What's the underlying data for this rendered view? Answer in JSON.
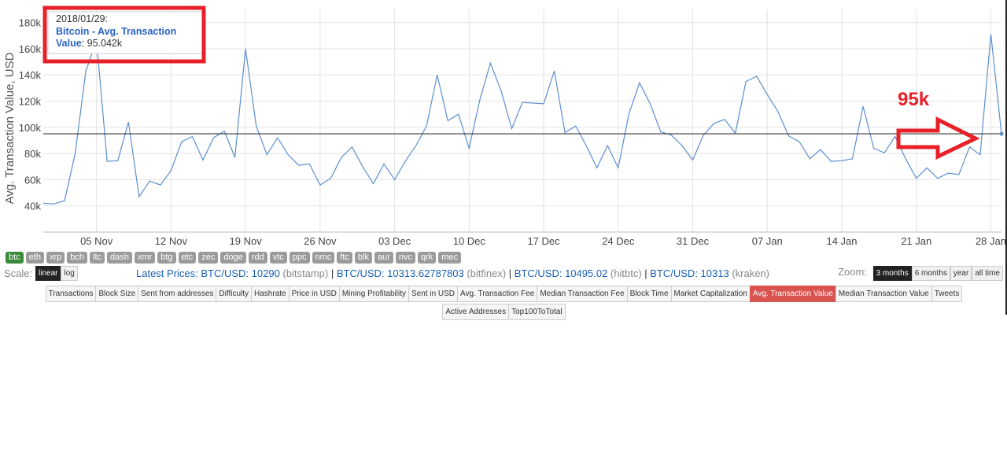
{
  "chart_data": {
    "type": "line",
    "ylabel": "Avg. Transaction Value, USD",
    "ylim": [
      20000,
      190000
    ],
    "yticks": [
      40000,
      60000,
      80000,
      100000,
      120000,
      140000,
      160000,
      180000
    ],
    "ytick_labels": [
      "40k",
      "60k",
      "80k",
      "100k",
      "120k",
      "140k",
      "160k",
      "180k"
    ],
    "xticks": [
      "2017-11-05",
      "2017-11-12",
      "2017-11-19",
      "2017-11-26",
      "2017-12-03",
      "2017-12-10",
      "2017-12-17",
      "2017-12-24",
      "2017-12-31",
      "2018-01-07",
      "2018-01-14",
      "2018-01-21",
      "2018-01-28"
    ],
    "xtick_labels": [
      "05 Nov",
      "12 Nov",
      "19 Nov",
      "26 Nov",
      "03 Dec",
      "10 Dec",
      "17 Dec",
      "24 Dec",
      "31 Dec",
      "07 Jan",
      "14 Jan",
      "21 Jan",
      "28 Jan"
    ],
    "x_start": "2017-10-31",
    "series": [
      {
        "name": "Bitcoin - Avg. Transaction Value",
        "color": "#5b8fd0",
        "values": [
          42000,
          41500,
          44000,
          80000,
          143000,
          166000,
          74000,
          74500,
          104000,
          47000,
          59000,
          56000,
          67000,
          89000,
          93000,
          75000,
          92000,
          97000,
          77000,
          160000,
          101000,
          79000,
          92000,
          79000,
          71000,
          72000,
          56000,
          61000,
          77000,
          85000,
          70000,
          57000,
          72000,
          60000,
          74000,
          86000,
          101000,
          140000,
          105000,
          110000,
          84000,
          121000,
          149000,
          128000,
          99000,
          119000,
          118500,
          118000,
          143000,
          96000,
          101000,
          86000,
          69000,
          86000,
          69000,
          110000,
          134000,
          118000,
          96500,
          94000,
          86000,
          75000,
          94000,
          103000,
          106000,
          95500,
          135000,
          139000,
          125000,
          112000,
          93500,
          89000,
          76000,
          83000,
          74000,
          74500,
          76000,
          116000,
          84000,
          80500,
          93000,
          76000,
          61000,
          69000,
          61000,
          65000,
          64000,
          85000,
          79000,
          171000,
          95042
        ]
      }
    ],
    "crosshair_value": 95042,
    "tooltip": {
      "date": "2018/01/29:",
      "series": "Bitcoin - Avg. Transaction",
      "series2": "Value",
      "value": "95.042k"
    },
    "annotation": "95k",
    "grid": true
  },
  "coins": [
    "btc",
    "eth",
    "xrp",
    "bch",
    "ltc",
    "dash",
    "xmr",
    "btg",
    "etc",
    "zec",
    "doge",
    "rdd",
    "vtc",
    "ppc",
    "nmc",
    "ftc",
    "blk",
    "aur",
    "nvc",
    "qrk",
    "mec"
  ],
  "active_coin": "btc",
  "scale": {
    "label": "Scale:",
    "options": [
      "linear",
      "log"
    ],
    "active": "linear"
  },
  "prices": {
    "label": "Latest Prices:",
    "items": [
      {
        "pair": "BTC/USD: 10290",
        "source": "(bitstamp)"
      },
      {
        "pair": "BTC/USD: 10313.62787803",
        "source": "(bitfinex)"
      },
      {
        "pair": "BTC/USD: 10495.02",
        "source": "(hitbtc)"
      },
      {
        "pair": "BTC/USD: 10313",
        "source": "(kraken)"
      }
    ]
  },
  "zoom": {
    "label": "Zoom:",
    "options": [
      "3 months",
      "6 months",
      "year",
      "all time"
    ],
    "active": "3 months"
  },
  "tabs": [
    "Transactions",
    "Block Size",
    "Sent from addresses",
    "Difficulty",
    "Hashrate",
    "Price in USD",
    "Mining Profitability",
    "Sent in USD",
    "Avg. Transaction Fee",
    "Median Transaction Fee",
    "Block Time",
    "Market Capitalization",
    "Avg. Transaction Value",
    "Median Transaction Value",
    "Tweets",
    "Active Addresses",
    "Top100ToTotal"
  ],
  "active_tab": "Avg. Transaction Value",
  "colors": {
    "line": "#5b8fd0",
    "highlight": "#e8202a",
    "active_tab": "#d9534f",
    "active_coin": "#3b8a3b"
  }
}
